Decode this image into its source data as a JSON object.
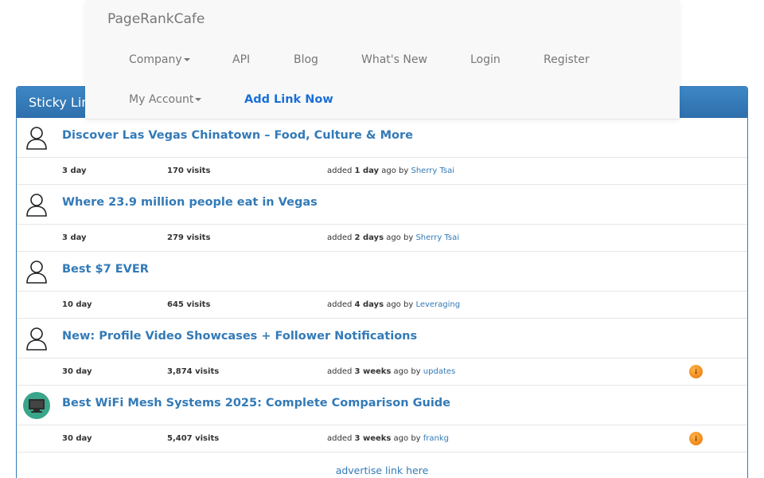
{
  "navbar": {
    "brand": "PageRankCafe",
    "items": [
      {
        "label": "Company",
        "dropdown": true
      },
      {
        "label": "API"
      },
      {
        "label": "Blog"
      },
      {
        "label": "What's New"
      },
      {
        "label": "Login"
      },
      {
        "label": "Register"
      },
      {
        "label": "My Account",
        "dropdown": true
      },
      {
        "label": "Add Link Now"
      }
    ]
  },
  "panel": {
    "heading": "Sticky Links",
    "items": [
      {
        "title": "Discover Las Vegas Chinatown – Food, Culture & More",
        "duration": "3 day",
        "visits": "170 visits",
        "added_prefix": "added ",
        "added_when": "1 day",
        "added_suffix": " ago by ",
        "user": "Sherry Tsai",
        "avatar": "person-outline-icon",
        "coin": ""
      },
      {
        "title": "Where 23.9 million people eat in Vegas",
        "duration": "3 day",
        "visits": "279 visits",
        "added_prefix": "added ",
        "added_when": "2 days",
        "added_suffix": " ago by ",
        "user": "Sherry Tsai",
        "avatar": "person-outline-icon",
        "coin": ""
      },
      {
        "title": "Best $7 EVER",
        "duration": "10 day",
        "visits": "645 visits",
        "added_prefix": "added ",
        "added_when": "4 days",
        "added_suffix": " ago by ",
        "user": "Leveraging",
        "avatar": "person-outline-icon",
        "coin": ""
      },
      {
        "title": "New: Profile Video Showcases + Follower Notifications",
        "duration": "30 day",
        "visits": "3,874 visits",
        "added_prefix": "added ",
        "added_when": "3 weeks",
        "added_suffix": " ago by ",
        "user": "updates",
        "avatar": "person-outline-icon",
        "coin": "coin-icon"
      },
      {
        "title": "Best WiFi Mesh Systems 2025: Complete Comparison Guide",
        "duration": "30 day",
        "visits": "5,407 visits",
        "added_prefix": "added ",
        "added_when": "3 weeks",
        "added_suffix": " ago by ",
        "user": "frankg",
        "avatar": "monitor-avatar-icon",
        "coin": "coin-icon"
      }
    ],
    "advertise": "advertise link here"
  },
  "colors": {
    "link": "#337ab7",
    "panel_heading": "#337ab7",
    "add_link": "#1a6fd8",
    "coin": "#f18a1c"
  }
}
